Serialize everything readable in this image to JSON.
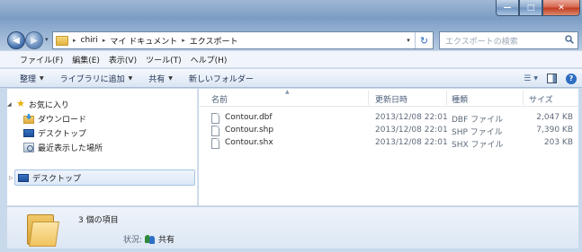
{
  "window": {
    "caption_buttons": {
      "minimize": "—",
      "maximize": "□",
      "close": "✕"
    }
  },
  "address_bar": {
    "crumbs": [
      "chiri",
      "マイ ドキュメント",
      "エクスポート"
    ],
    "separator": "▸"
  },
  "search": {
    "placeholder": "エクスポートの検索"
  },
  "menu": [
    "ファイル(F)",
    "編集(E)",
    "表示(V)",
    "ツール(T)",
    "ヘルプ(H)"
  ],
  "toolbar": {
    "organize": "整理",
    "add_to_library": "ライブラリに追加",
    "share": "共有",
    "new_folder": "新しいフォルダー"
  },
  "nav_pane": {
    "favorites": "お気に入り",
    "downloads": "ダウンロード",
    "desktop": "デスクトップ",
    "recent": "最近表示した場所",
    "desktop_root": "デスクトップ"
  },
  "columns": {
    "name": "名前",
    "modified": "更新日時",
    "type": "種類",
    "size": "サイズ"
  },
  "files": [
    {
      "name": "Contour.dbf",
      "modified": "2013/12/08 22:01",
      "type": "DBF ファイル",
      "size": "2,047 KB"
    },
    {
      "name": "Contour.shp",
      "modified": "2013/12/08 22:01",
      "type": "SHP ファイル",
      "size": "7,390 KB"
    },
    {
      "name": "Contour.shx",
      "modified": "2013/12/08 22:01",
      "type": "SHX ファイル",
      "size": "203 KB"
    }
  ],
  "details": {
    "item_count": "3 個の項目",
    "status_label": "状況:",
    "status_value": "共有"
  }
}
